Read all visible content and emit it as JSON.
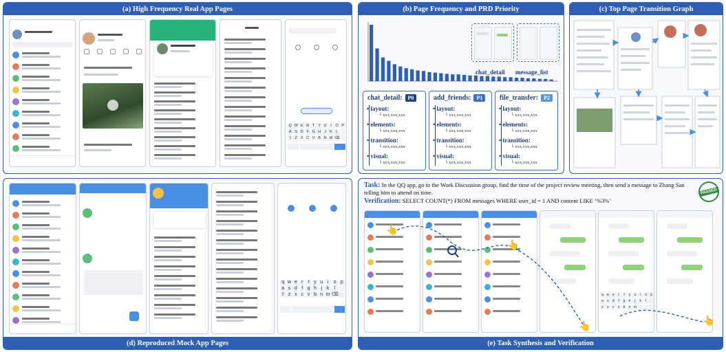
{
  "panels": {
    "a": {
      "title": "(a) High Frequency Real App Pages"
    },
    "b": {
      "title": "(b) Page Frequency and PRD Priority"
    },
    "c": {
      "title": "(c) Top Page Transition Graph"
    },
    "d": {
      "title": "(d) Reproduced Mock App Pages"
    },
    "e": {
      "title": "(e) Task Synthesis and Verification"
    }
  },
  "chart_data": {
    "type": "bar",
    "values": [
      100,
      58,
      42,
      36,
      30,
      26,
      23,
      21,
      19,
      18,
      16,
      15,
      14,
      13,
      12,
      12,
      11,
      10,
      10,
      9,
      9,
      8,
      8,
      7,
      7,
      6,
      6,
      5,
      5,
      4,
      4,
      3
    ],
    "annotations": [
      "chat_detail",
      "message_list"
    ],
    "color": "#2e5fb5"
  },
  "prd": [
    {
      "name": "chat_detail:",
      "priority": "P0",
      "badge_color": "#1c3f86"
    },
    {
      "name": "add_friends:",
      "priority": "P1",
      "badge_color": "#3d6fc2"
    },
    {
      "name": "file_transfer:",
      "priority": "P2",
      "badge_color": "#5b95d8"
    }
  ],
  "prd_fields": [
    "layout:",
    "elements:",
    "transition:",
    "visual:"
  ],
  "prd_value": "xxx,xxx,xxx",
  "task": {
    "task_label": "Task:",
    "task_text": "In the QQ app, go to the Work Discussion group, find the time of the project review meeting, then send a message to Zhang San telling him to attend on time.",
    "verify_label": "Verification:",
    "verify_text": "SELECT COUNT(*) FROM messages WHERE user_id = 1 AND content LIKE ‘%3%’",
    "stamp": "PASSED"
  },
  "colors": {
    "primary": "#2e5fb5",
    "qq_blue": "#4a90e2",
    "chat_green": "#8fd27a",
    "stamp_green": "#2e8b3e"
  }
}
